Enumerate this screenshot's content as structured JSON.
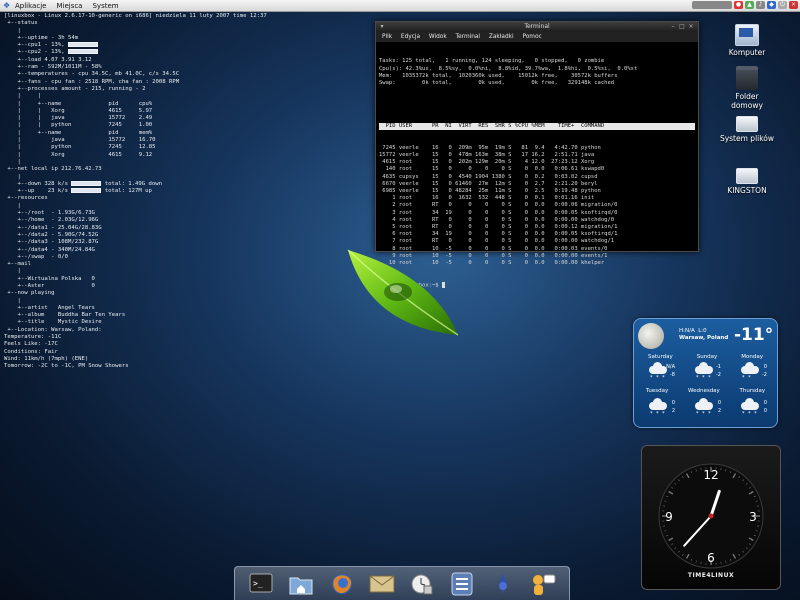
{
  "top_panel": {
    "menus": [
      "Aplikacje",
      "Miejsca",
      "System"
    ]
  },
  "conky": {
    "lines": [
      "[linuxbox - Linux 2.6.17-10-generic on i686] niedziela 11 luty 2007 time 12:37",
      "",
      " +--status",
      "    |",
      "    +--uptime - 3h 54m",
      "    +--cpu1 - 13%, [bar]",
      "    +--cpu2 - 13%, [bar]",
      "    +--load 4.07 3.91 3.12",
      "    +--ram - 592M/1011M - 58%",
      "    +--temperatures - cpu 34.5C, mb 41.0C, c/s 34.5C",
      "    +--fans - cpu fan : 2518 RPM, cha fan : 2008 RPM",
      "    +--processes amount - 215, running - 2",
      "    |     |",
      "    |     +--name              pid      cpu%",
      "    |     |   Xorg             4615     5.97",
      "    |     |   java             15772    2.49",
      "    |     |   python           7245     1.00",
      "    |     +--name              pid      mem%",
      "    |         java             15772    16.70",
      "    |         python           7245     12.85",
      "    |         Xorg             4615     9.12",
      "    |",
      " +--net local ip 212.76.42.73",
      "    |",
      "    +--down 328 k/s [bar] total: 1.49G down",
      "    +--up    23 k/s [bar] total: 127M up",
      "",
      " +--resources",
      "    |",
      "    +--/root  - 1.93G/6.73G",
      "    +--/home  - 2.03G/12.96G",
      "    +--/data1 - 25.04G/28.83G",
      "    +--/data2 - 5.90G/74.52G",
      "    +--/data3 - 108M/232.87G",
      "    +--/data4 - 340M/24.84G",
      "    +--/swap  - 0/0",
      "",
      " +--mail",
      "    |",
      "    +--Wirtualna Polska   0",
      "    +--Aster              0",
      "",
      " +--now playing",
      "    |",
      "    +--artist   Angel Tears",
      "    +--album    Buddha Bar Ten Years",
      "    +--title    Mystic Desire",
      "",
      " +--Location: Warsaw, Poland:",
      "Temperature: -11C",
      "Feels Like: -17C",
      "Conditions: Fair",
      "Wind: 11km/h (7mph) (ENE)",
      "Tomorrow: -2C to -1C, PM Snow Showers"
    ]
  },
  "terminal": {
    "title": "Terminal",
    "menu": [
      "Plik",
      "Edycja",
      "Widok",
      "Terminal",
      "Zakładki",
      "Pomoc"
    ],
    "summary": [
      "Tasks: 125 total,   1 running, 124 sleeping,   0 stopped,   0 zombie",
      "Cpu(s): 42.3%us,  8.5%sy,  0.0%ni,  8.8%id, 39.7%wa,  1.8%hi,  0.5%si,  0.0%st",
      "Mem:   1035372k total,  1020360k used,    15012k free,    30572k buffers",
      "Swap:        0k total,        0k used,        0k free,   329148k cached"
    ],
    "header": "  PID USER      PR  NI  VIRT  RES  SHR S %CPU %MEM    TIME+  COMMAND           ",
    "rows": [
      " 7245 veerle    16   0  209m  95m  19m S   81  9.4   4:42.70 python",
      "15772 veerle    15   0  478m 163m  38m S   17 16.2   2:51.71 java",
      " 4615 root      15   0  202m 129m  20m S    4 12.0  27:23.12 Xorg",
      "  140 root      15   0     0    0    0 S    0  0.0   0:06.61 kswapd0",
      " 4635 cupsys    15   0  4540 1904 1380 S    0  0.2   0:03.02 cupsd",
      " 6670 veerle    15   0 61460  27m  12m S    0  2.7   2:21.20 beryl",
      " 6985 veerle    15   0 48284  25m  11m S    0  2.5   0:19.48 python",
      "    1 root      16   0  1632  532  448 S    0  0.1   0:01.16 init",
      "    2 root      RT   0     0    0    0 S    0  0.0   0:00.06 migration/0",
      "    3 root      34  19     0    0    0 S    0  0.0   0:00.05 ksoftirqd/0",
      "    4 root      RT   0     0    0    0 S    0  0.0   0:00.00 watchdog/0",
      "    5 root      RT   0     0    0    0 S    0  0.0   0:00.12 migration/1",
      "    6 root      34  19     0    0    0 S    0  0.0   0:00.05 ksoftirqd/1",
      "    7 root      RT   0     0    0    0 S    0  0.0   0:00.00 watchdog/1",
      "    8 root      10  -5     0    0    0 S    0  0.0   0:00.03 events/0",
      "    9 root      10  -5     0    0    0 S    0  0.0   0:00.00 events/1",
      "   10 root      10  -5     0    0    0 S    0  0.0   0:00.00 khelper"
    ],
    "prompt": "veerle@linuxbox:~$ "
  },
  "desktop_icons": [
    {
      "label": "Komputer",
      "icon": "computer-icon"
    },
    {
      "label": "Folder domowy",
      "icon": "home-folder-icon"
    },
    {
      "label": "System plików",
      "icon": "filesystem-icon"
    },
    {
      "label": "KINGSTON",
      "icon": "usb-drive-icon"
    }
  ],
  "weather": {
    "humidity": "H:N/A",
    "wind": "L:0",
    "location": "Warsaw, Poland",
    "temperature": "-11°",
    "days_row1": [
      "Saturday",
      "Sunday",
      "Monday"
    ],
    "days_row2": [
      "Tuesday",
      "Wednesday",
      "Thursday"
    ],
    "forecast_row1": [
      {
        "hi": "N/A",
        "lo": "-8"
      },
      {
        "hi": "-1",
        "lo": "-2"
      },
      {
        "hi": "0",
        "lo": "-2"
      }
    ],
    "forecast_row2": [
      {
        "hi": "0",
        "lo": "2"
      },
      {
        "hi": "0",
        "lo": "2"
      },
      {
        "hi": "0",
        "lo": "0"
      }
    ]
  },
  "clock": {
    "numerals": [
      "12",
      "3",
      "6",
      "9"
    ],
    "brand": "TIME4LINUX",
    "hour": 12,
    "minute": 37
  },
  "dock": [
    "terminal-icon",
    "home-folder-icon",
    "firefox-icon",
    "mail-icon",
    "clock-settings-icon",
    "list-icon",
    "config-icon",
    "chat-icon"
  ]
}
